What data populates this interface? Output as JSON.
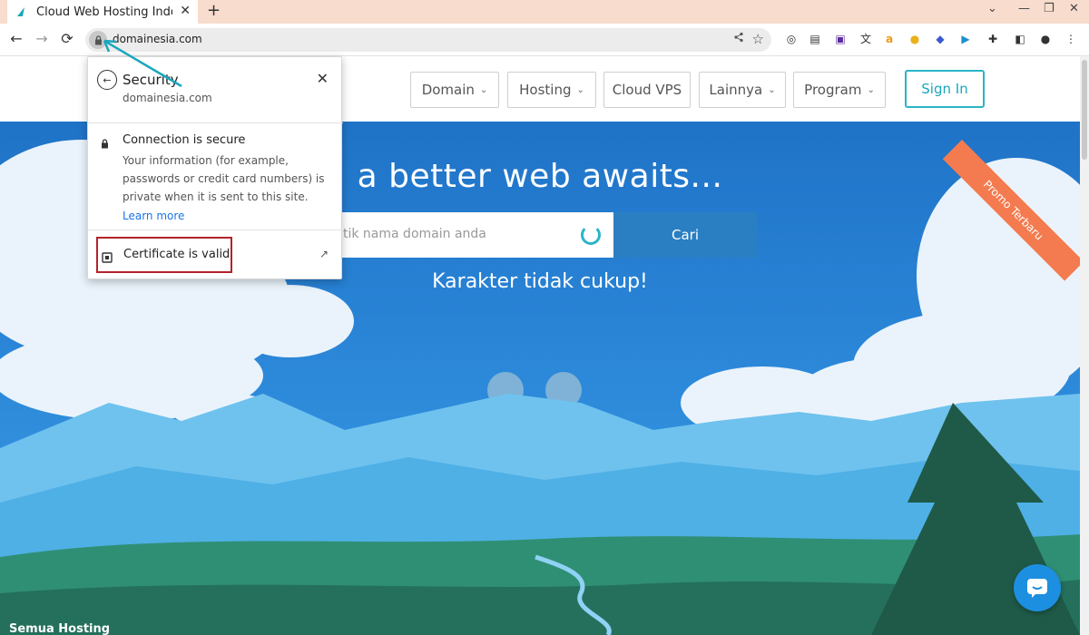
{
  "browser": {
    "tab_title": "Cloud Web Hosting Indo",
    "url": "domainesia.com",
    "window_controls": [
      "⌄",
      "—",
      "❐",
      "✕"
    ],
    "nav": {
      "back": "←",
      "forward": "→",
      "reload": "⟳"
    },
    "newtab": "+",
    "close_tab": "✕"
  },
  "site": {
    "nav_items": [
      "Domain",
      "Hosting",
      "Cloud VPS",
      "Lainnya",
      "Program"
    ],
    "signin": "Sign In",
    "headline": "a better web awaits...",
    "search_placeholder": "tik nama domain anda",
    "search_button": "Cari",
    "validation": "Karakter tidak cukup!",
    "promo": "Promo Terbaru",
    "bottom_tag": "Semua Hosting"
  },
  "popup": {
    "title": "Security",
    "domain": "domainesia.com",
    "secure_label": "Connection is secure",
    "description": "Your information (for example, passwords or credit card numbers) is private when it is sent to this site.",
    "learn_more": "Learn more",
    "certificate": "Certificate is valid"
  },
  "colors": {
    "accent": "#2bb5c9",
    "highlight": "#b3232b",
    "promo": "#f47b4f",
    "sky": "#2b86d8"
  }
}
